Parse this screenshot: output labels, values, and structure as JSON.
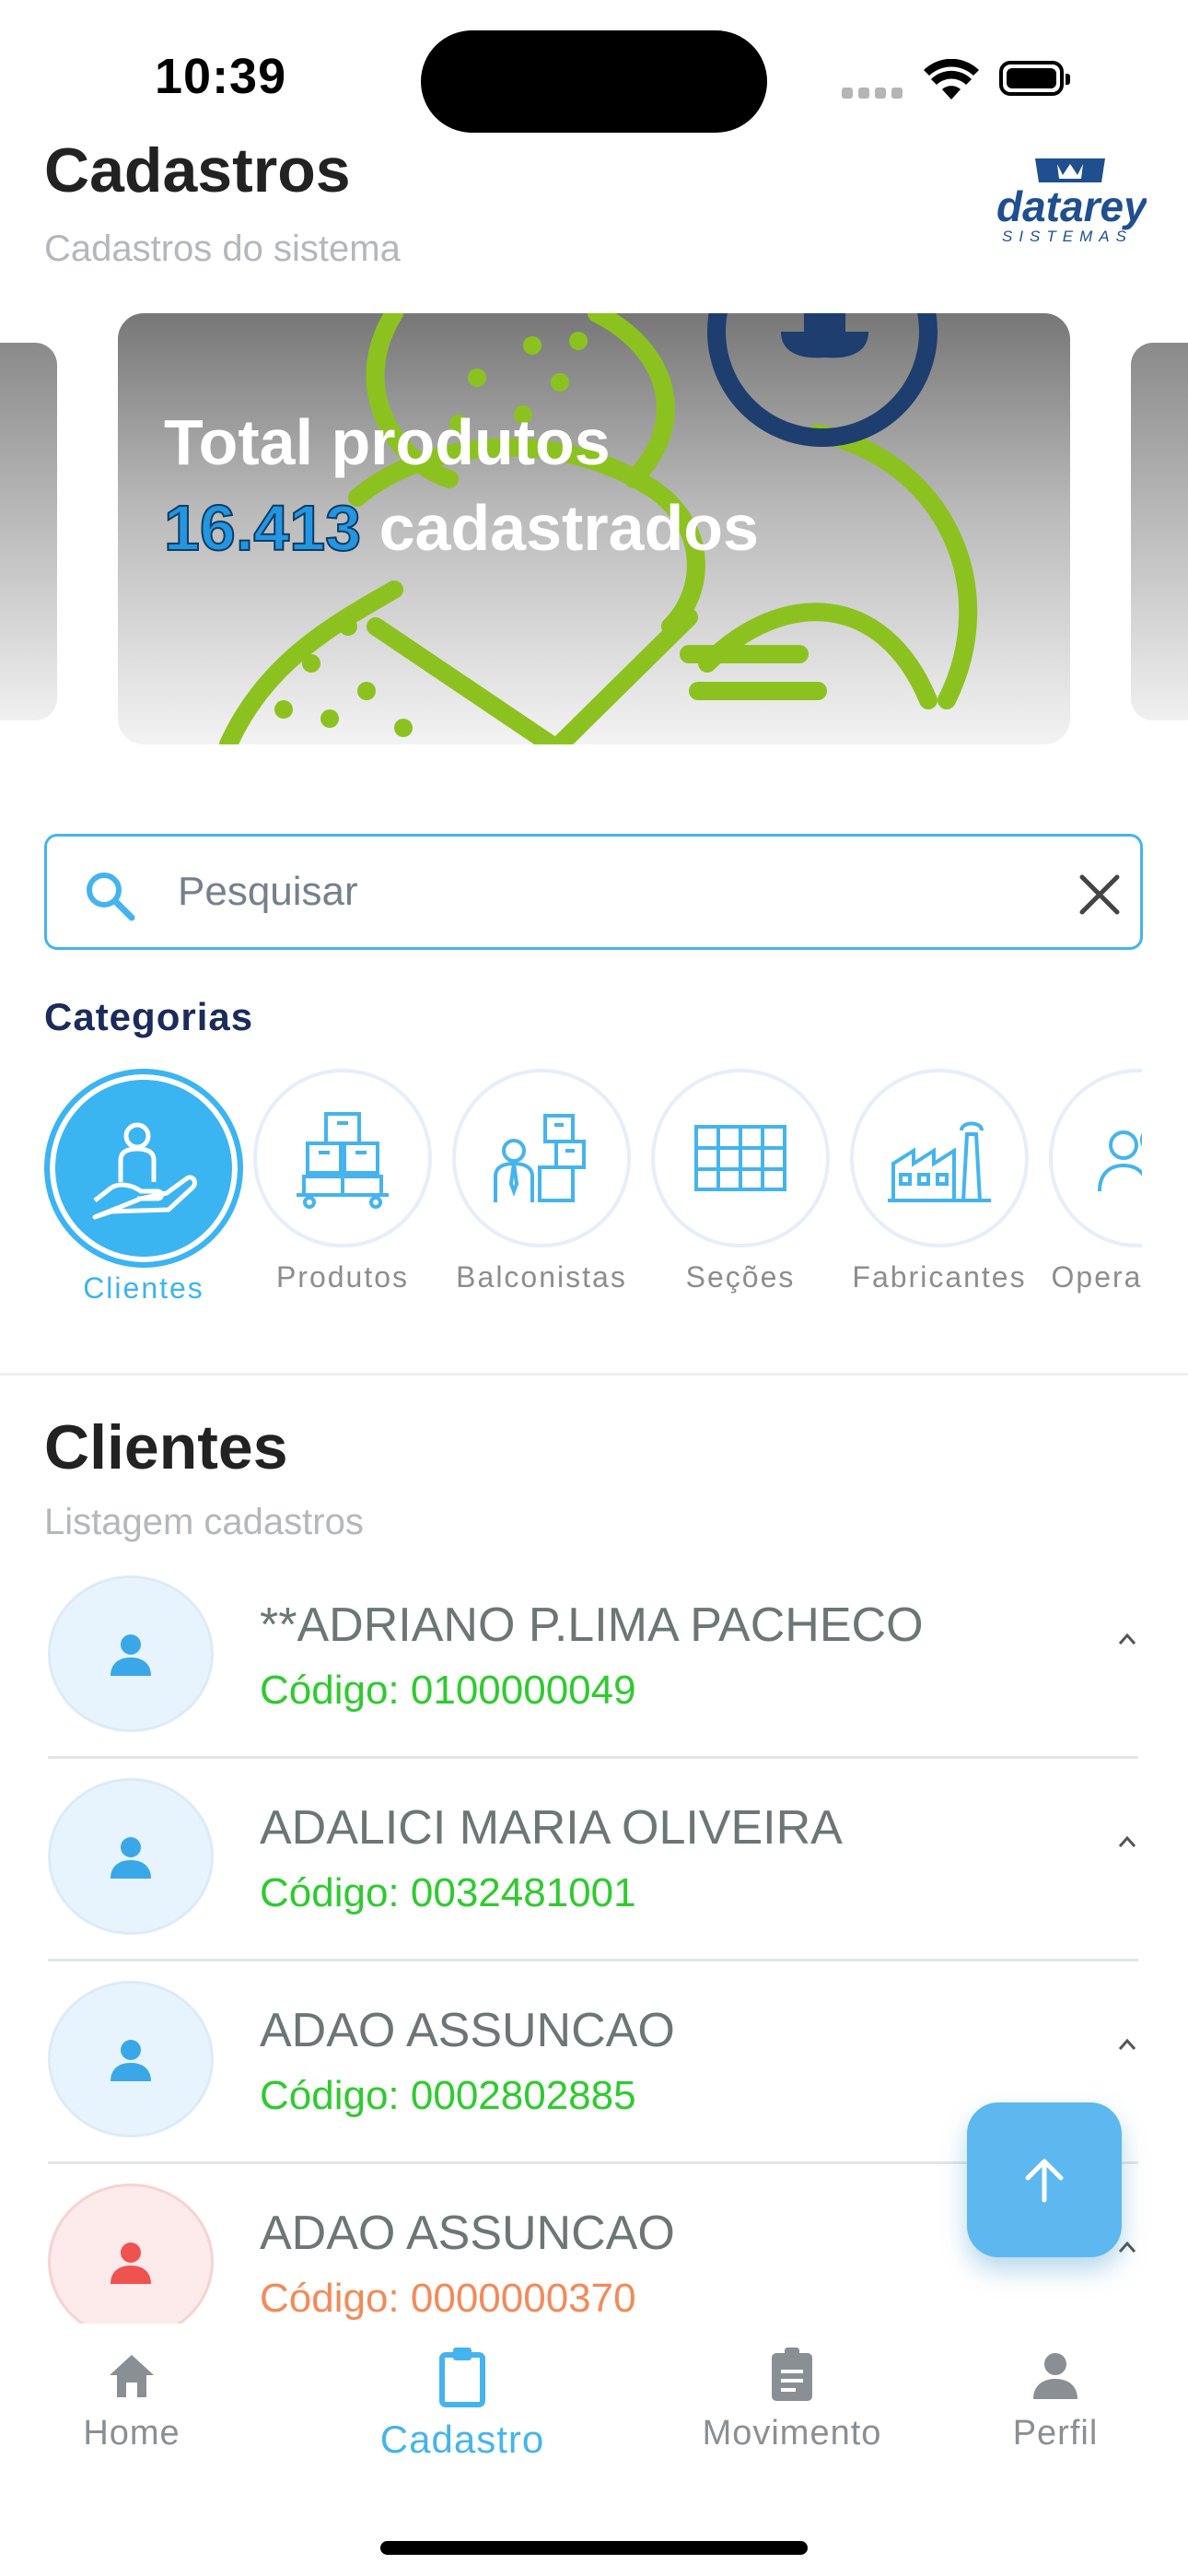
{
  "status_bar": {
    "time": "10:39"
  },
  "header": {
    "title": "Cadastros",
    "subtitle": "Cadastros do sistema",
    "logo_text": "datarey",
    "logo_subtext": "SISTEMAS"
  },
  "banner": {
    "line1": "Total produtos",
    "count": "16.413",
    "suffix": "cadastrados"
  },
  "search": {
    "placeholder": "Pesquisar",
    "value": ""
  },
  "categories": {
    "title": "Categorias",
    "items": [
      {
        "label": "Clientes",
        "icon": "client-hand-icon",
        "active": true
      },
      {
        "label": "Produtos",
        "icon": "boxes-icon",
        "active": false
      },
      {
        "label": "Balconistas",
        "icon": "clerk-icon",
        "active": false
      },
      {
        "label": "Seções",
        "icon": "sections-grid-icon",
        "active": false
      },
      {
        "label": "Fabricantes",
        "icon": "factory-icon",
        "active": false
      },
      {
        "label": "Operadores",
        "icon": "operators-icon",
        "active": false
      }
    ]
  },
  "list": {
    "title": "Clientes",
    "subtitle": "Listagem cadastros",
    "rows": [
      {
        "name": "**ADRIANO P.LIMA PACHECO",
        "code": "Código: 0100000049",
        "status": "normal"
      },
      {
        "name": "ADALICI MARIA OLIVEIRA",
        "code": "Código: 0032481001",
        "status": "normal"
      },
      {
        "name": "ADAO ASSUNCAO",
        "code": "Código: 0002802885",
        "status": "normal"
      },
      {
        "name": "ADAO ASSUNCAO",
        "code": "Código: 0000000370",
        "status": "alert"
      }
    ]
  },
  "nav": {
    "items": [
      {
        "label": "Home",
        "icon": "home-icon"
      },
      {
        "label": "Cadastro",
        "icon": "clipboard-icon",
        "active": true
      },
      {
        "label": "Movimento",
        "icon": "document-icon"
      },
      {
        "label": "Perfil",
        "icon": "person-icon"
      }
    ]
  },
  "colors": {
    "accent": "#45b4ee",
    "title_dark": "#1b2b5b",
    "code_green": "#2ecb2e",
    "code_alert": "#f38a58",
    "banner_number": "#2496e0"
  }
}
